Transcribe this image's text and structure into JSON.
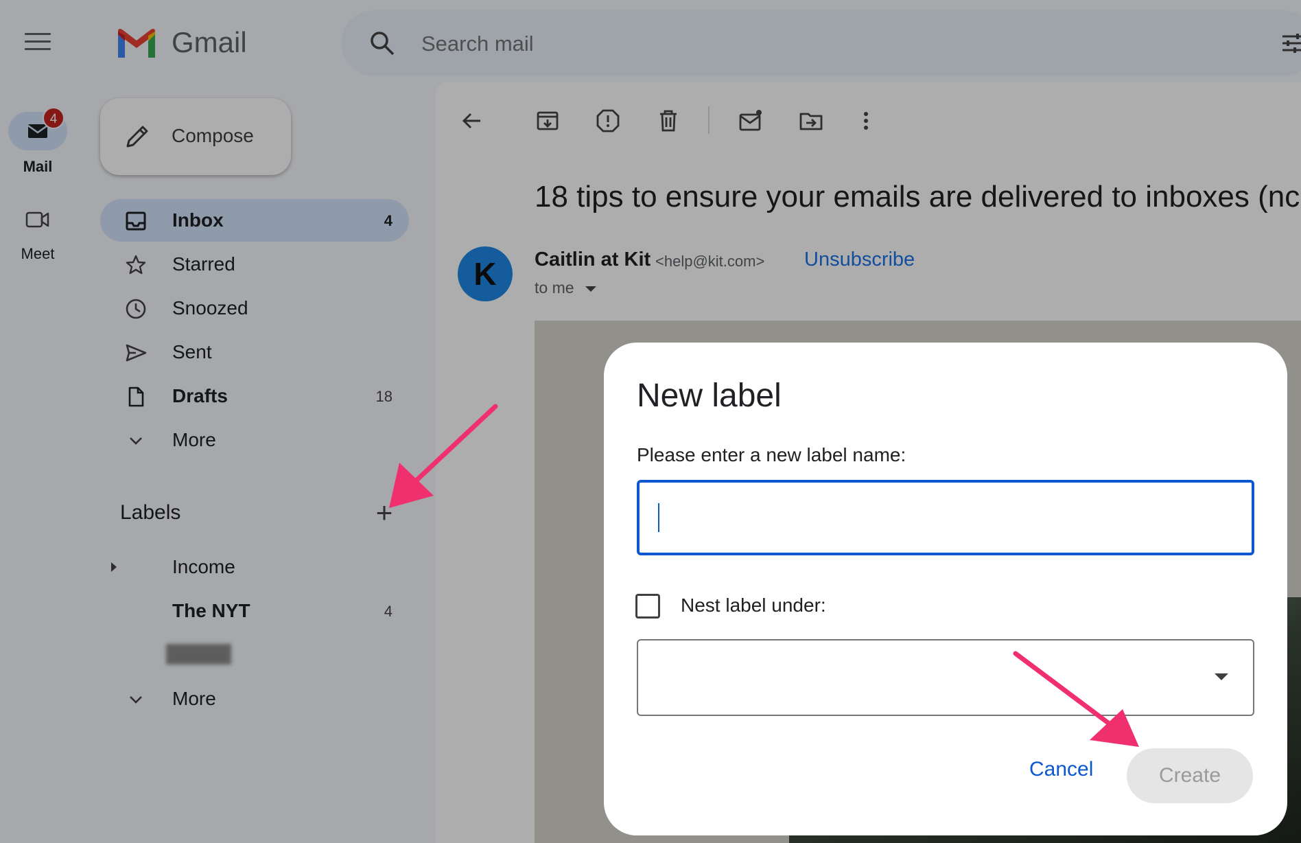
{
  "app": {
    "name": "Gmail",
    "search_placeholder": "Search mail"
  },
  "rail": {
    "mail_label": "Mail",
    "mail_badge": "4",
    "meet_label": "Meet"
  },
  "compose_label": "Compose",
  "nav": [
    {
      "label": "Inbox",
      "count": "4",
      "icon": "inbox-icon",
      "active": true,
      "bold": true
    },
    {
      "label": "Starred",
      "count": "",
      "icon": "star-icon"
    },
    {
      "label": "Snoozed",
      "count": "",
      "icon": "clock-icon"
    },
    {
      "label": "Sent",
      "count": "",
      "icon": "send-icon"
    },
    {
      "label": "Drafts",
      "count": "18",
      "icon": "draft-icon",
      "bold": true
    },
    {
      "label": "More",
      "count": "",
      "icon": "chevron-down-icon"
    }
  ],
  "labels": {
    "heading": "Labels",
    "items": [
      {
        "label": "Income",
        "count": ""
      },
      {
        "label": "The NYT",
        "count": "4",
        "bold": true
      }
    ],
    "more_label": "More"
  },
  "email": {
    "subject": "18 tips to ensure your emails are delivered to inboxes (nc",
    "sender_name": "Caitlin at Kit",
    "sender_email": "<help@kit.com>",
    "unsubscribe": "Unsubscribe",
    "to": "to me",
    "avatar_letter": "K"
  },
  "dialog": {
    "title": "New label",
    "prompt": "Please enter a new label name:",
    "input_value": "",
    "nest_label": "Nest label under:",
    "nest_checked": false,
    "nest_value": "",
    "cancel_label": "Cancel",
    "create_label": "Create"
  },
  "colors": {
    "accent": "#0b57d0",
    "annotation_arrow": "#f0306e",
    "badge": "#c5221f",
    "link": "#1a73e8"
  }
}
